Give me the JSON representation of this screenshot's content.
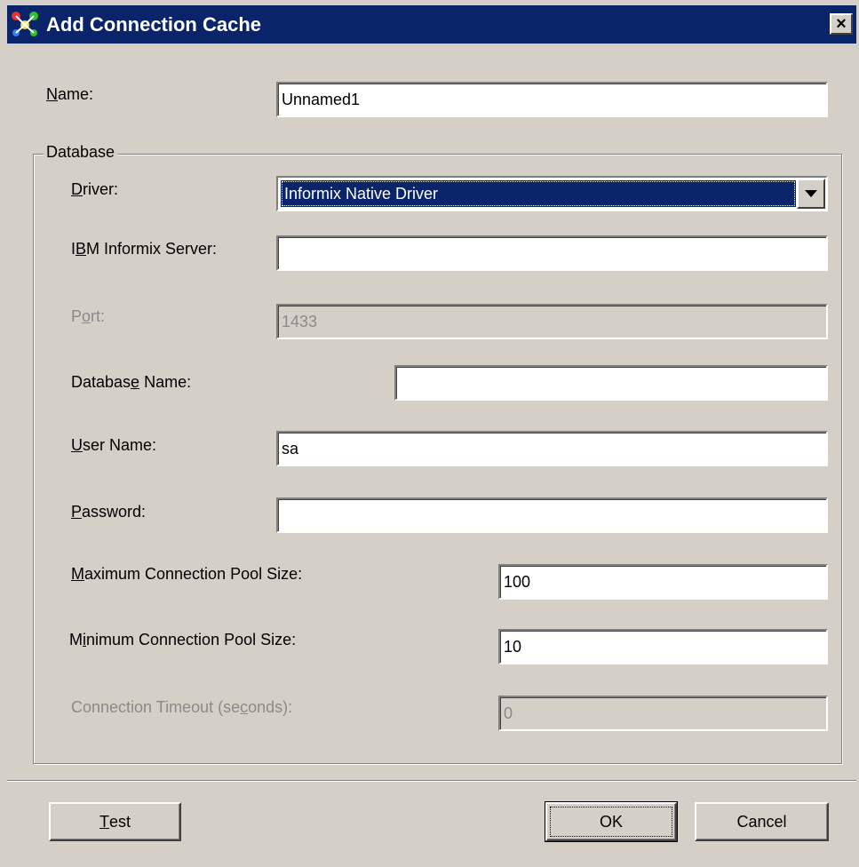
{
  "window": {
    "title": "Add Connection Cache",
    "close_label": "×"
  },
  "form": {
    "name": {
      "label_prefix": "",
      "label_mnemonic": "N",
      "label_suffix": "ame:",
      "value": "Unnamed1"
    },
    "database_group_label": "Database",
    "driver": {
      "label_prefix": "",
      "label_mnemonic": "D",
      "label_suffix": "river:",
      "selected": "Informix Native Driver"
    },
    "server": {
      "label_prefix": "I",
      "label_mnemonic": "B",
      "label_suffix": "M Informix Server:",
      "value": ""
    },
    "port": {
      "label_prefix": "P",
      "label_mnemonic": "o",
      "label_suffix": "rt:",
      "value": "1433"
    },
    "database_name": {
      "label_prefix": "Databas",
      "label_mnemonic": "e",
      "label_suffix": " Name:",
      "value": ""
    },
    "user_name": {
      "label_prefix": "",
      "label_mnemonic": "U",
      "label_suffix": "ser Name:",
      "value": "sa"
    },
    "password": {
      "label_prefix": "",
      "label_mnemonic": "P",
      "label_suffix": "assword:",
      "value": ""
    },
    "max_pool": {
      "label_prefix": "",
      "label_mnemonic": "M",
      "label_suffix": "aximum Connection Pool Size:",
      "value": "100"
    },
    "min_pool": {
      "label_prefix": "M",
      "label_mnemonic": "i",
      "label_suffix": "nimum Connection Pool Size:",
      "value": "10"
    },
    "timeout": {
      "label_prefix": "Connection Timeout (se",
      "label_mnemonic": "c",
      "label_suffix": "onds):",
      "value": "0"
    }
  },
  "buttons": {
    "test": {
      "mnemonic": "T",
      "rest": "est"
    },
    "ok": "OK",
    "cancel": "Cancel"
  }
}
